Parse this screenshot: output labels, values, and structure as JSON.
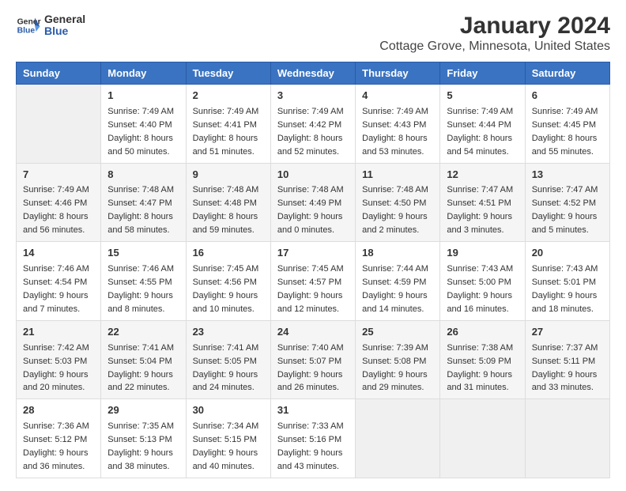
{
  "header": {
    "logo_line1": "General",
    "logo_line2": "Blue",
    "title": "January 2024",
    "subtitle": "Cottage Grove, Minnesota, United States"
  },
  "days_of_week": [
    "Sunday",
    "Monday",
    "Tuesday",
    "Wednesday",
    "Thursday",
    "Friday",
    "Saturday"
  ],
  "weeks": [
    [
      {
        "day": "",
        "info": ""
      },
      {
        "day": "1",
        "info": "Sunrise: 7:49 AM\nSunset: 4:40 PM\nDaylight: 8 hours\nand 50 minutes."
      },
      {
        "day": "2",
        "info": "Sunrise: 7:49 AM\nSunset: 4:41 PM\nDaylight: 8 hours\nand 51 minutes."
      },
      {
        "day": "3",
        "info": "Sunrise: 7:49 AM\nSunset: 4:42 PM\nDaylight: 8 hours\nand 52 minutes."
      },
      {
        "day": "4",
        "info": "Sunrise: 7:49 AM\nSunset: 4:43 PM\nDaylight: 8 hours\nand 53 minutes."
      },
      {
        "day": "5",
        "info": "Sunrise: 7:49 AM\nSunset: 4:44 PM\nDaylight: 8 hours\nand 54 minutes."
      },
      {
        "day": "6",
        "info": "Sunrise: 7:49 AM\nSunset: 4:45 PM\nDaylight: 8 hours\nand 55 minutes."
      }
    ],
    [
      {
        "day": "7",
        "info": "Sunrise: 7:49 AM\nSunset: 4:46 PM\nDaylight: 8 hours\nand 56 minutes."
      },
      {
        "day": "8",
        "info": "Sunrise: 7:48 AM\nSunset: 4:47 PM\nDaylight: 8 hours\nand 58 minutes."
      },
      {
        "day": "9",
        "info": "Sunrise: 7:48 AM\nSunset: 4:48 PM\nDaylight: 8 hours\nand 59 minutes."
      },
      {
        "day": "10",
        "info": "Sunrise: 7:48 AM\nSunset: 4:49 PM\nDaylight: 9 hours\nand 0 minutes."
      },
      {
        "day": "11",
        "info": "Sunrise: 7:48 AM\nSunset: 4:50 PM\nDaylight: 9 hours\nand 2 minutes."
      },
      {
        "day": "12",
        "info": "Sunrise: 7:47 AM\nSunset: 4:51 PM\nDaylight: 9 hours\nand 3 minutes."
      },
      {
        "day": "13",
        "info": "Sunrise: 7:47 AM\nSunset: 4:52 PM\nDaylight: 9 hours\nand 5 minutes."
      }
    ],
    [
      {
        "day": "14",
        "info": "Sunrise: 7:46 AM\nSunset: 4:54 PM\nDaylight: 9 hours\nand 7 minutes."
      },
      {
        "day": "15",
        "info": "Sunrise: 7:46 AM\nSunset: 4:55 PM\nDaylight: 9 hours\nand 8 minutes."
      },
      {
        "day": "16",
        "info": "Sunrise: 7:45 AM\nSunset: 4:56 PM\nDaylight: 9 hours\nand 10 minutes."
      },
      {
        "day": "17",
        "info": "Sunrise: 7:45 AM\nSunset: 4:57 PM\nDaylight: 9 hours\nand 12 minutes."
      },
      {
        "day": "18",
        "info": "Sunrise: 7:44 AM\nSunset: 4:59 PM\nDaylight: 9 hours\nand 14 minutes."
      },
      {
        "day": "19",
        "info": "Sunrise: 7:43 AM\nSunset: 5:00 PM\nDaylight: 9 hours\nand 16 minutes."
      },
      {
        "day": "20",
        "info": "Sunrise: 7:43 AM\nSunset: 5:01 PM\nDaylight: 9 hours\nand 18 minutes."
      }
    ],
    [
      {
        "day": "21",
        "info": "Sunrise: 7:42 AM\nSunset: 5:03 PM\nDaylight: 9 hours\nand 20 minutes."
      },
      {
        "day": "22",
        "info": "Sunrise: 7:41 AM\nSunset: 5:04 PM\nDaylight: 9 hours\nand 22 minutes."
      },
      {
        "day": "23",
        "info": "Sunrise: 7:41 AM\nSunset: 5:05 PM\nDaylight: 9 hours\nand 24 minutes."
      },
      {
        "day": "24",
        "info": "Sunrise: 7:40 AM\nSunset: 5:07 PM\nDaylight: 9 hours\nand 26 minutes."
      },
      {
        "day": "25",
        "info": "Sunrise: 7:39 AM\nSunset: 5:08 PM\nDaylight: 9 hours\nand 29 minutes."
      },
      {
        "day": "26",
        "info": "Sunrise: 7:38 AM\nSunset: 5:09 PM\nDaylight: 9 hours\nand 31 minutes."
      },
      {
        "day": "27",
        "info": "Sunrise: 7:37 AM\nSunset: 5:11 PM\nDaylight: 9 hours\nand 33 minutes."
      }
    ],
    [
      {
        "day": "28",
        "info": "Sunrise: 7:36 AM\nSunset: 5:12 PM\nDaylight: 9 hours\nand 36 minutes."
      },
      {
        "day": "29",
        "info": "Sunrise: 7:35 AM\nSunset: 5:13 PM\nDaylight: 9 hours\nand 38 minutes."
      },
      {
        "day": "30",
        "info": "Sunrise: 7:34 AM\nSunset: 5:15 PM\nDaylight: 9 hours\nand 40 minutes."
      },
      {
        "day": "31",
        "info": "Sunrise: 7:33 AM\nSunset: 5:16 PM\nDaylight: 9 hours\nand 43 minutes."
      },
      {
        "day": "",
        "info": ""
      },
      {
        "day": "",
        "info": ""
      },
      {
        "day": "",
        "info": ""
      }
    ]
  ]
}
